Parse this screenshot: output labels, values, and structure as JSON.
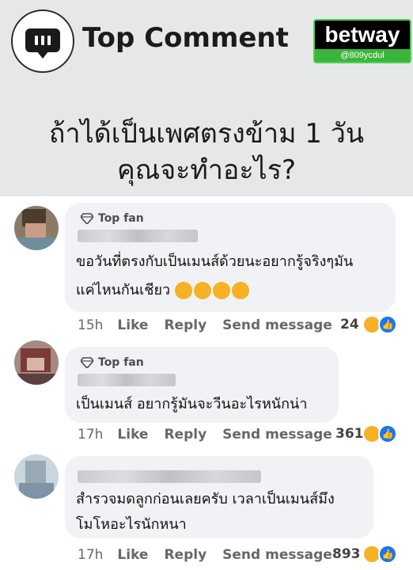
{
  "header": {
    "title": "Top Comment",
    "brand": "betway",
    "handle": "@809ycdul",
    "question_line1": "ถ้าได้เป็นเพศตรงข้าม 1 วัน",
    "question_line2": "คุณจะทำอะไร?"
  },
  "comments": [
    {
      "badge": "Top fan",
      "line1": "ขอวันที่ตรงกับเป็นเมนส์ด้วยนะอยากรู้จริงๆมัน",
      "line2": "แค่ไหนกันเชียว",
      "time": "15h",
      "like": "Like",
      "reply": "Reply",
      "send": "Send message",
      "count": "24"
    },
    {
      "badge": "Top fan",
      "line1": "เป็นเมนส์ อยากรู้มันจะวีนอะไรหนักน่า",
      "time": "17h",
      "like": "Like",
      "reply": "Reply",
      "send": "Send message",
      "count": "361"
    },
    {
      "line1": "สำรวจมดลูกก่อนเลยครับ เวลาเป็นเมนส์มึง",
      "line2": "โมโหอะไรนักหนา",
      "time": "17h",
      "like": "Like",
      "reply": "Reply",
      "send": "Send message",
      "count": "893"
    }
  ],
  "colors": {
    "header_bg": "#e6e7e9",
    "bubble_bg": "#f0f2f5",
    "meta_text": "#65676b",
    "brand_green": "#3bb53b",
    "like_blue": "#1877f2",
    "haha_yellow": "#f7b125"
  },
  "icons": [
    "comment-bubble-icon",
    "diamond-icon",
    "thinking-emoji-icon",
    "haha-reaction-icon",
    "like-reaction-icon"
  ]
}
